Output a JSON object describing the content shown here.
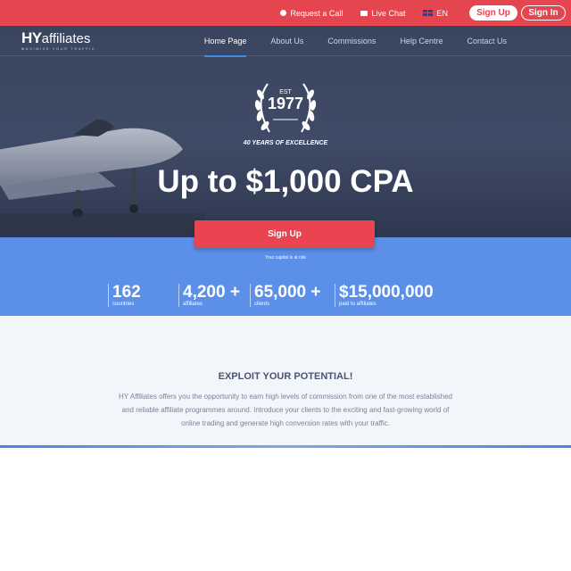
{
  "topbar": {
    "request_call": "Request a Call",
    "live_chat": "Live Chat",
    "language": "EN",
    "sign_up": "Sign Up",
    "sign_in": "Sign In"
  },
  "logo": {
    "mark": "HY",
    "word": "affiliates",
    "tagline": "MAXIMIZE YOUR TRAFFIC"
  },
  "nav": {
    "items": [
      "Home Page",
      "About Us",
      "Commissions",
      "Help Centre",
      "Contact Us"
    ],
    "active": "Home Page"
  },
  "hero": {
    "badge_est": "EST",
    "badge_year": "1977",
    "badge_caption": "40 YEARS OF EXCELLENCE",
    "headline": "Up to $1,000 CPA",
    "cta": "Sign Up",
    "risk_note": "Your capital is at risk"
  },
  "stats": [
    {
      "value": "162",
      "label": "countries"
    },
    {
      "value": "4,200 +",
      "label": "affiliates"
    },
    {
      "value": "65,000 +",
      "label": "clients"
    },
    {
      "value": "$15,000,000",
      "label": "paid to affiliates"
    }
  ],
  "intro": {
    "heading": "EXPLOIT YOUR POTENTIAL!",
    "body": "HY Affiliates offers you the opportunity to earn high levels of commission from one of the most established and reliable affiliate programmes around. Introduce your clients to the exciting and fast-growing world of online trading and generate high conversion rates with your traffic."
  },
  "colors": {
    "topbar": "#e5454f",
    "hero": "#3f4a66",
    "stats_band": "#5b8fe8",
    "intro_bg": "#f2f5fa",
    "accent_underline": "#3c8ee6"
  }
}
